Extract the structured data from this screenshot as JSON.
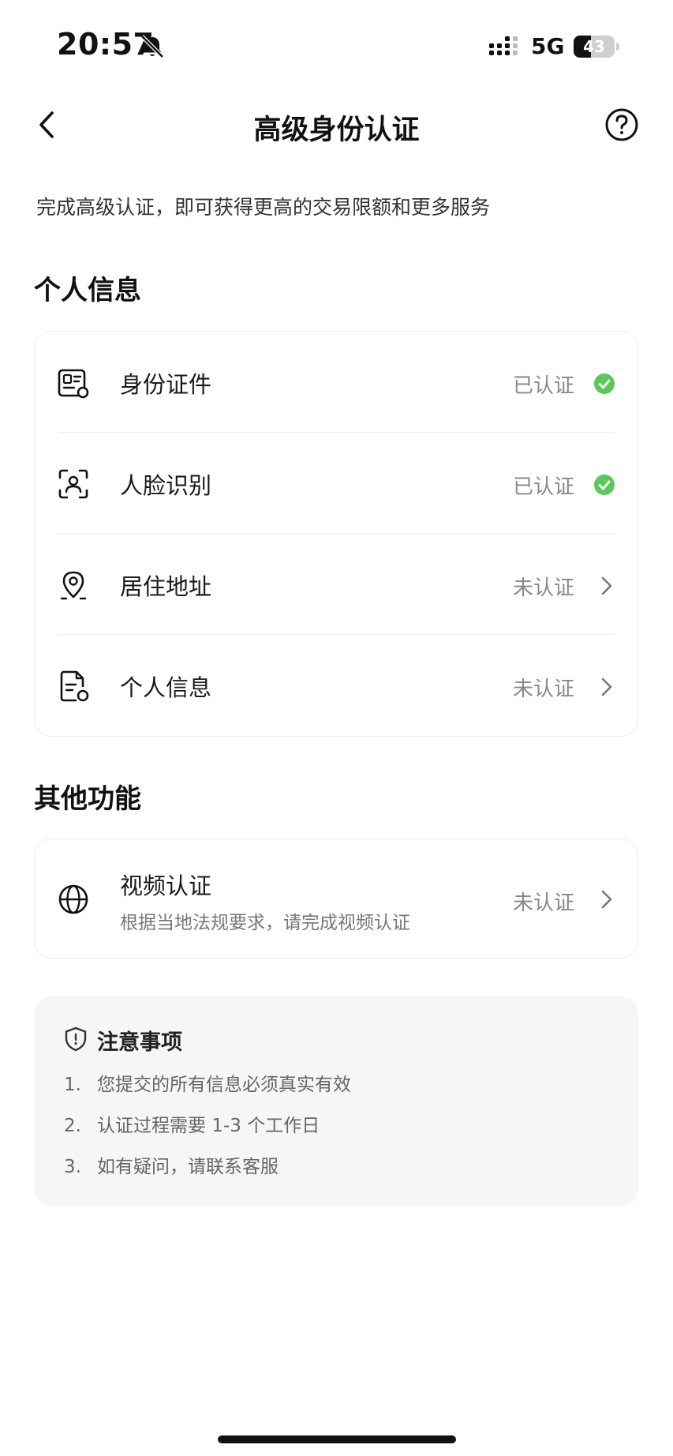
{
  "status_bar": {
    "time": "20:57",
    "network": "5G",
    "battery_level": "43",
    "battery_fraction": 0.43
  },
  "nav": {
    "title": "高级身份认证"
  },
  "subtitle": "完成高级认证，即可获得更高的交易限额和更多服务",
  "personal_section": {
    "title": "个人信息",
    "items": [
      {
        "label": "身份证件",
        "status": "已认证",
        "icon": "id-card-icon"
      },
      {
        "label": "人脸识别",
        "status": "已认证",
        "icon": "face-scan-icon"
      },
      {
        "label": "居住地址",
        "status": "未认证",
        "icon": "location-pin-icon"
      },
      {
        "label": "个人信息",
        "status": "未认证",
        "icon": "document-icon"
      }
    ]
  },
  "other_section": {
    "title": "其他功能",
    "video": {
      "title": "视频认证",
      "description": "根据当地法规要求，请完成视频认证",
      "status": "未认证",
      "icon": "globe-icon"
    }
  },
  "notice": {
    "title": "注意事项",
    "items": [
      {
        "num": "1.",
        "text": "您提交的所有信息必须真实有效"
      },
      {
        "num": "2.",
        "text": "认证过程需要 1-3 个工作日"
      },
      {
        "num": "3.",
        "text": "如有疑问，请联系客服"
      }
    ]
  },
  "colors": {
    "verified_green": "#5cc85c",
    "muted_text": "#888888"
  }
}
